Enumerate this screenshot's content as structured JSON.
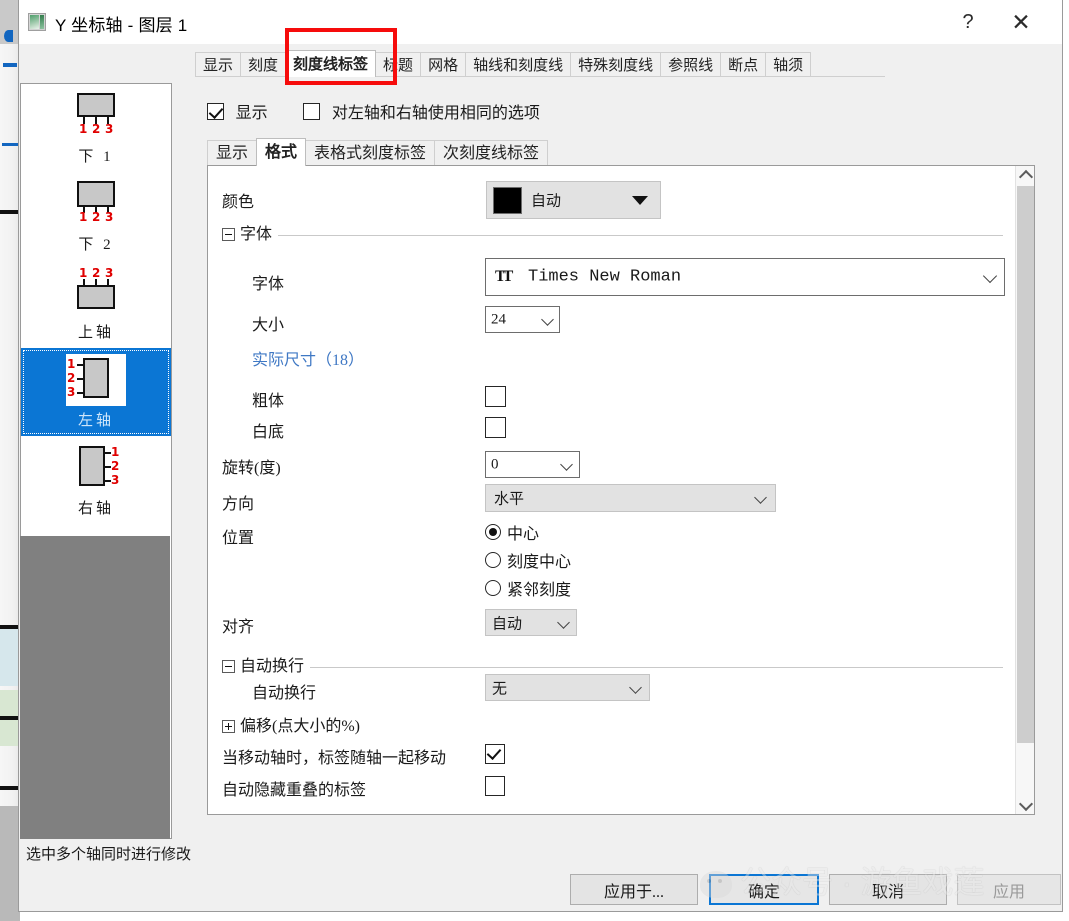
{
  "window": {
    "title": "Y 坐标轴 - 图层 1",
    "icon": "axis-dialog-icon",
    "help_label": "?",
    "close_label": "✕"
  },
  "outer_tabs": [
    {
      "label": "显示",
      "active": false
    },
    {
      "label": "刻度",
      "active": false
    },
    {
      "label": "刻度线标签",
      "active": true
    },
    {
      "label": "标题",
      "active": false
    },
    {
      "label": "网格",
      "active": false
    },
    {
      "label": "轴线和刻度线",
      "active": false
    },
    {
      "label": "特殊刻度线",
      "active": false
    },
    {
      "label": "参照线",
      "active": false
    },
    {
      "label": "断点",
      "active": false
    },
    {
      "label": "轴须",
      "active": false
    }
  ],
  "axis_list": [
    {
      "label": "下 1",
      "selected": false,
      "icon": "axis-bottom1-icon"
    },
    {
      "label": "下 2",
      "selected": false,
      "icon": "axis-bottom2-icon"
    },
    {
      "label": "上轴",
      "selected": false,
      "icon": "axis-top-icon"
    },
    {
      "label": "左轴",
      "selected": true,
      "icon": "axis-left-icon"
    },
    {
      "label": "右轴",
      "selected": false,
      "icon": "axis-right-icon"
    }
  ],
  "checkboxes_top": {
    "show": {
      "label": "显示",
      "checked": true
    },
    "same_for_both": {
      "label": "对左轴和右轴使用相同的选项",
      "checked": false
    }
  },
  "inner_tabs": [
    {
      "label": "显示",
      "active": false
    },
    {
      "label": "格式",
      "active": true
    },
    {
      "label": "表格式刻度标签",
      "active": false
    },
    {
      "label": "次刻度线标签",
      "active": false
    }
  ],
  "form": {
    "color": {
      "label": "颜色",
      "value": "自动",
      "swatch": "#000000"
    },
    "font_group": {
      "label": "字体",
      "expanded": true
    },
    "font": {
      "label": "字体",
      "value": "Times New Roman",
      "icon": "truetype-icon"
    },
    "size": {
      "label": "大小",
      "value": "24"
    },
    "actual_size": {
      "label": "实际尺寸（18）"
    },
    "bold": {
      "label": "粗体",
      "checked": false
    },
    "white_background": {
      "label": "白底",
      "checked": false
    },
    "rotate": {
      "label": "旋转(度)",
      "value": "0"
    },
    "direction": {
      "label": "方向",
      "value": "水平"
    },
    "position": {
      "label": "位置",
      "options": [
        {
          "label": "中心",
          "selected": true
        },
        {
          "label": "刻度中心",
          "selected": false
        },
        {
          "label": "紧邻刻度",
          "selected": false
        }
      ]
    },
    "align": {
      "label": "对齐",
      "value": "自动"
    },
    "wrap_group": {
      "label": "自动换行",
      "expanded": true
    },
    "wrap": {
      "label": "自动换行",
      "value": "无"
    },
    "offset_group": {
      "label": "偏移(点大小的%)",
      "expanded": false
    },
    "move_with_axis": {
      "label": "当移动轴时，标签随轴一起移动",
      "checked": true
    },
    "auto_hide_overlap": {
      "label": "自动隐藏重叠的标签",
      "checked": false
    }
  },
  "statusbar": {
    "text": "选中多个轴同时进行修改"
  },
  "buttons": {
    "apply_to": "应用于...",
    "ok": "确定",
    "cancel": "取消",
    "apply": "应用"
  },
  "watermark": {
    "text": "公众号 · 游鱼戏莲"
  },
  "colors": {
    "accent": "#0b76d4",
    "annotation": "#f60c0c",
    "link": "#3f78c4",
    "selection": "#0b76d4"
  }
}
